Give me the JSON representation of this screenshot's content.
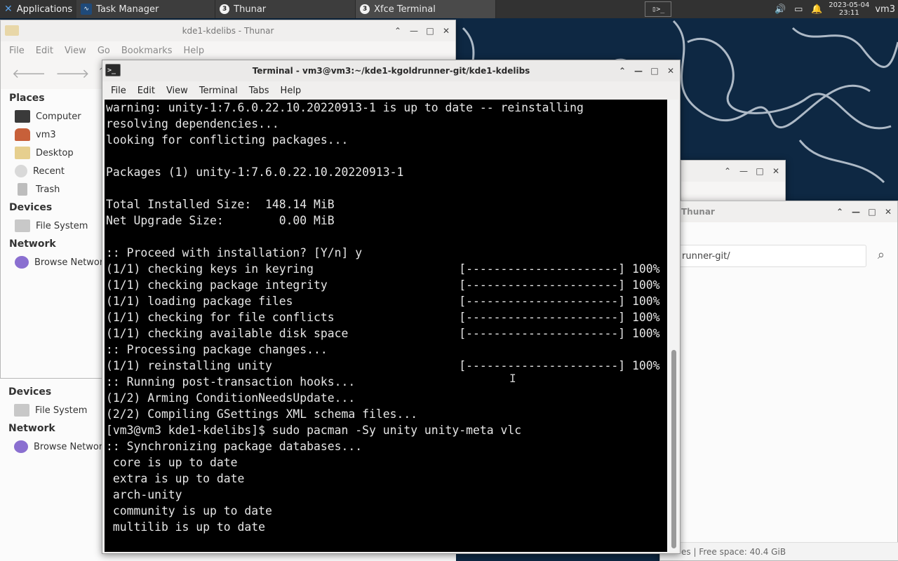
{
  "panel": {
    "applications_label": "Applications",
    "tasks": [
      {
        "label": "Task Manager"
      },
      {
        "label": "Thunar",
        "badge": "3"
      },
      {
        "label": "Xfce Terminal",
        "badge": "3"
      }
    ],
    "clock_date": "2023-05-04",
    "clock_time": "23:11",
    "user": "vm3"
  },
  "thunar_main": {
    "title": "kde1-kdelibs - Thunar",
    "menu": [
      "File",
      "Edit",
      "View",
      "Go",
      "Bookmarks",
      "Help"
    ],
    "places_header": "Places",
    "places": [
      {
        "label": "Computer",
        "icon": "computer-icon"
      },
      {
        "label": "vm3",
        "icon": "home-icon"
      },
      {
        "label": "Desktop",
        "icon": "folder-icon"
      },
      {
        "label": "Recent",
        "icon": "clock-icon"
      },
      {
        "label": "Trash",
        "icon": "trash-icon"
      }
    ],
    "devices_header": "Devices",
    "devices": [
      {
        "label": "File System",
        "icon": "drive-icon"
      }
    ],
    "network_header": "Network",
    "network": [
      {
        "label": "Browse Network",
        "icon": "network-icon"
      }
    ]
  },
  "thunar_second": {
    "devices_header": "Devices",
    "devices_item": "File System",
    "network_header": "Network",
    "network_item": "Browse Network"
  },
  "thunar_right": {
    "title": "Thunar",
    "path": "runner-git/",
    "status": "es  |  Free space: 40.4 GiB"
  },
  "terminal": {
    "title": "Terminal - vm3@vm3:~/kde1-kgoldrunner-git/kde1-kdelibs",
    "menu": [
      "File",
      "Edit",
      "View",
      "Terminal",
      "Tabs",
      "Help"
    ],
    "lines": [
      "warning: unity-1:7.6.0.22.10.20220913-1 is up to date -- reinstalling",
      "resolving dependencies...",
      "looking for conflicting packages...",
      "",
      "Packages (1) unity-1:7.6.0.22.10.20220913-1",
      "",
      "Total Installed Size:  148.14 MiB",
      "Net Upgrade Size:        0.00 MiB",
      "",
      ":: Proceed with installation? [Y/n] y",
      "(1/1) checking keys in keyring                     [----------------------] 100%",
      "(1/1) checking package integrity                   [----------------------] 100%",
      "(1/1) loading package files                        [----------------------] 100%",
      "(1/1) checking for file conflicts                  [----------------------] 100%",
      "(1/1) checking available disk space                [----------------------] 100%",
      ":: Processing package changes...",
      "(1/1) reinstalling unity                           [----------------------] 100%",
      ":: Running post-transaction hooks...",
      "(1/2) Arming ConditionNeedsUpdate...",
      "(2/2) Compiling GSettings XML schema files...",
      "[vm3@vm3 kde1-kdelibs]$ sudo pacman -Sy unity unity-meta vlc",
      ":: Synchronizing package databases...",
      " core is up to date",
      " extra is up to date",
      " arch-unity",
      " community is up to date",
      " multilib is up to date"
    ]
  }
}
